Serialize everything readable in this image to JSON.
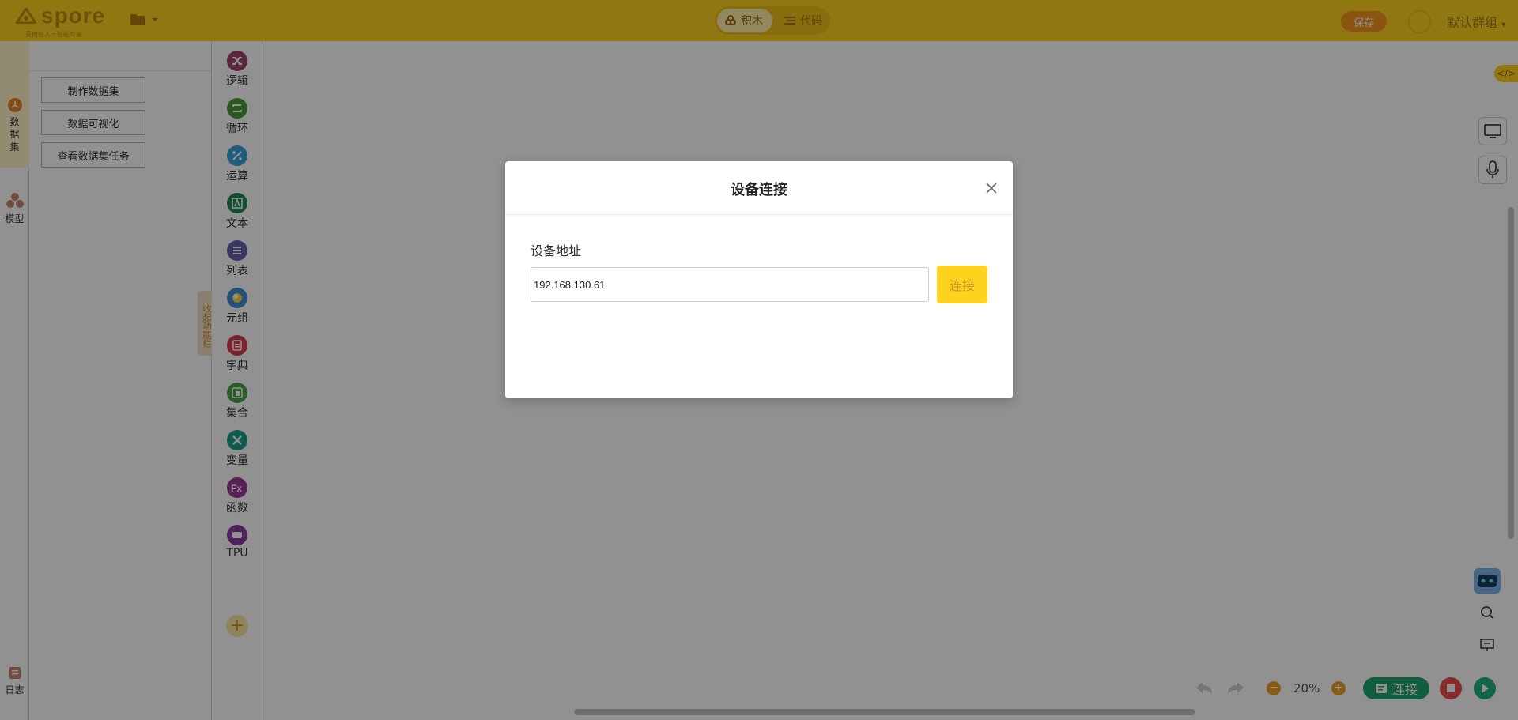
{
  "header": {
    "logo_text": "spore",
    "logo_subtitle": "青树智人工智能专家",
    "mode_blocks_label": "积木",
    "mode_code_label": "代码",
    "save_label": "保存",
    "group_label": "默认群组"
  },
  "nav": {
    "items": [
      {
        "label": "数据集",
        "icon": "dataset-icon"
      },
      {
        "label": "模型",
        "icon": "model-icon"
      },
      {
        "label": "日志",
        "icon": "log-icon"
      }
    ]
  },
  "panel": {
    "buttons": [
      "制作数据集",
      "数据可视化",
      "查看数据集任务"
    ],
    "collapse_label": "收起功能栏"
  },
  "categories": [
    {
      "label": "逻辑",
      "color": "#a0416e",
      "icon": "shuffle-icon"
    },
    {
      "label": "循环",
      "color": "#4e9b3c",
      "icon": "loop-icon"
    },
    {
      "label": "运算",
      "color": "#35a4d8",
      "icon": "percent-icon"
    },
    {
      "label": "文本",
      "color": "#1e8a58",
      "icon": "text-icon"
    },
    {
      "label": "列表",
      "color": "#6461b3",
      "icon": "list-icon"
    },
    {
      "label": "元组",
      "color": "#3f8fd8",
      "icon": "tuple-icon"
    },
    {
      "label": "字典",
      "color": "#d63a4a",
      "icon": "dictionary-icon"
    },
    {
      "label": "集合",
      "color": "#4ba04d",
      "icon": "set-icon"
    },
    {
      "label": "变量",
      "color": "#1aa085",
      "icon": "variable-icon"
    },
    {
      "label": "函数",
      "color": "#9a3a9a",
      "icon": "function-icon"
    },
    {
      "label": "TPU",
      "color": "#8e3aa6",
      "icon": "tpu-icon"
    }
  ],
  "categories_add": "+",
  "workspace": {
    "code_tag": "</>",
    "zoom_label": "20%",
    "connect_label": "连接"
  },
  "modal": {
    "title": "设备连接",
    "field_label": "设备地址",
    "address_value": "192.168.130.61",
    "connect_label": "连接"
  }
}
